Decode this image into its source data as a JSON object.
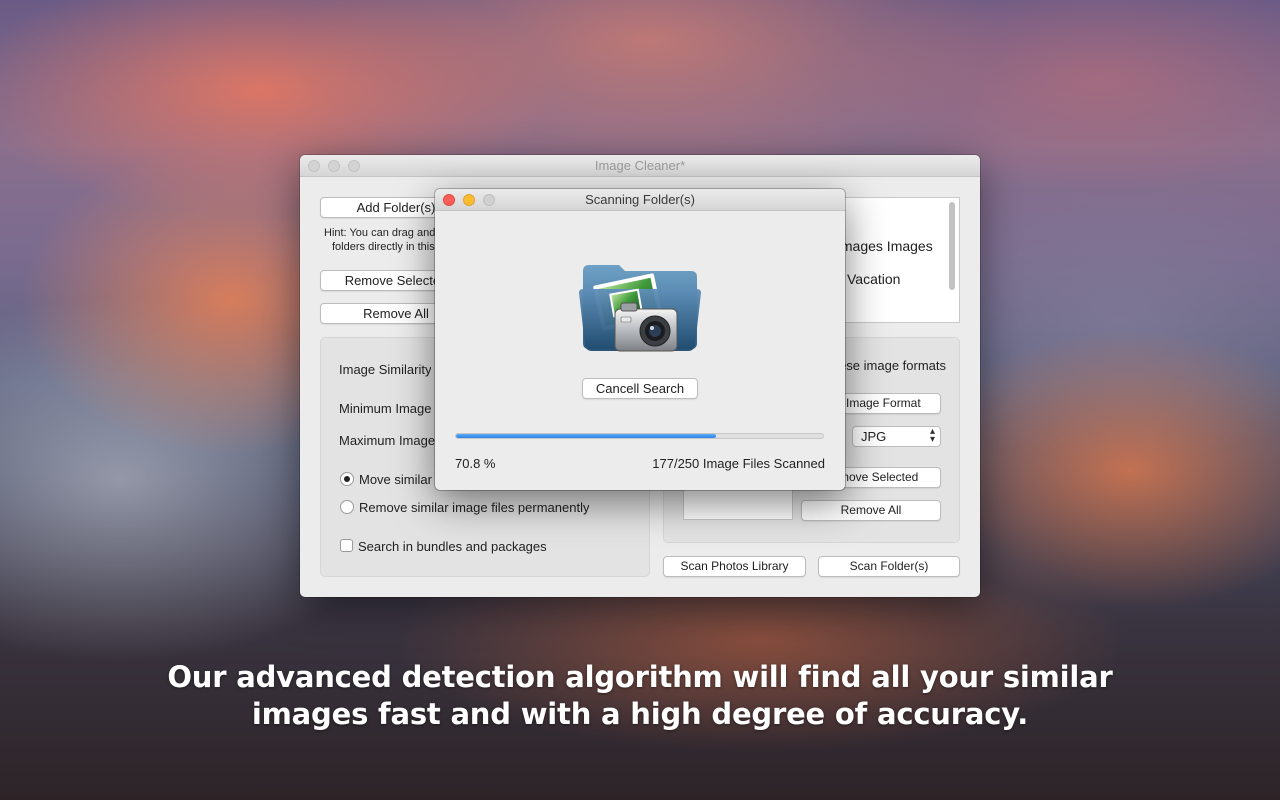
{
  "main_window": {
    "title": "Image Cleaner*",
    "add_folder_label": "Add Folder(s)",
    "hint_line1": "Hint: You can drag and drop",
    "hint_line2": "folders directly in this list",
    "remove_selected_label": "Remove Selected",
    "remove_all_label": "Remove All",
    "folder_list": [
      "Images Images",
      "Vacation"
    ],
    "similarity_label": "Image Similarity",
    "min_size_label": "Minimum Image Size",
    "max_size_label": "Maximum Image Size",
    "move_option_label": "Move similar image files to trash",
    "remove_option_label": "Remove similar image files permanently",
    "bundles_label": "Search in bundles and packages",
    "formats_label": "Search these image formats",
    "add_format_label": "Add Image Format",
    "format_select_value": "JPG",
    "formats_remove_selected_label": "Remove Selected",
    "formats_remove_all_label": "Remove All",
    "scan_photos_label": "Scan Photos Library",
    "scan_folders_label": "Scan Folder(s)"
  },
  "scan_dialog": {
    "title": "Scanning Folder(s)",
    "cancel_label": "Cancell Search",
    "percent_text": "70.8 %",
    "progress_fraction": 0.708,
    "status_text": "177/250 Image Files Scanned"
  },
  "caption": {
    "line1": "Our advanced detection algorithm will find all your similar",
    "line2": "images fast and with a high degree of accuracy."
  },
  "colors": {
    "progress": "#2f86ea",
    "close": "#fc5f57",
    "minimize": "#fdbc2e"
  }
}
